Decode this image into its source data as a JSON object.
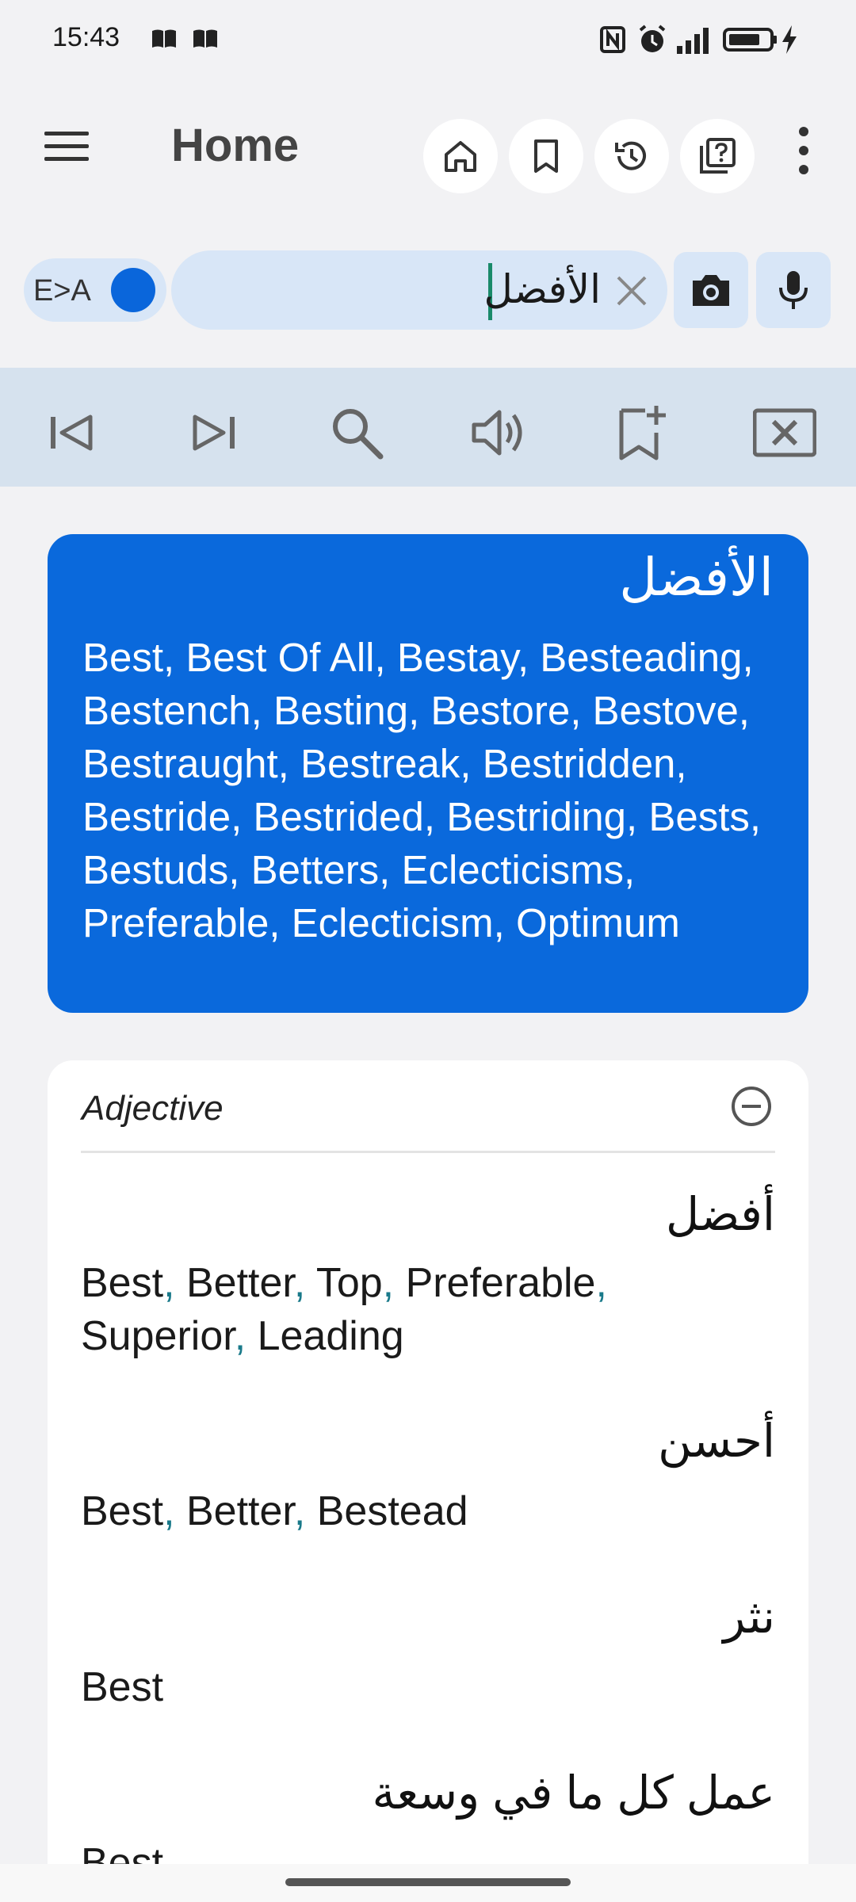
{
  "status_bar": {
    "time": "15:43",
    "left_icons": [
      "book-icon",
      "book-icon"
    ],
    "right_icons": [
      "nfc-icon",
      "alarm-icon",
      "signal-icon",
      "battery-icon",
      "charging-icon"
    ]
  },
  "app_bar": {
    "title": "Home",
    "actions": [
      "home-icon",
      "bookmark-icon",
      "history-icon",
      "quiz-icon",
      "overflow-icon"
    ]
  },
  "search": {
    "lang_toggle_label": "E>A",
    "query": "الأفضل",
    "buttons": [
      "camera-icon",
      "microphone-icon"
    ]
  },
  "toolbar": {
    "icons": [
      "skip-previous-icon",
      "skip-next-icon",
      "search-icon",
      "speaker-icon",
      "bookmark-add-icon",
      "close-box-icon"
    ]
  },
  "summary": {
    "word": "الأفضل",
    "translations": "Best, Best Of All, Bestay, Besteading, Bestench, Besting, Bestore, Bestove, Bestraught, Bestreak, Bestridden, Bestride, Bestrided, Bestriding, Bests, Bestuds, Betters, Eclecticisms, Preferable, Eclecticism, Optimum"
  },
  "detail": {
    "part_of_speech": "Adjective",
    "entries": [
      {
        "arabic": "أفضل",
        "english": [
          "Best",
          "Better",
          "Top",
          "Preferable",
          "Superior",
          "Leading"
        ]
      },
      {
        "arabic": "أحسن",
        "english": [
          "Best",
          "Better",
          "Bestead"
        ]
      },
      {
        "arabic": "نثر",
        "english": [
          "Best"
        ]
      },
      {
        "arabic": "عمل كل ما في وسعة",
        "english": [
          "Best"
        ]
      }
    ]
  },
  "colors": {
    "accent": "#0a69dc",
    "search_bg": "#d8e6f7",
    "toolbar_bg": "#d6e2ee",
    "background": "#f2f2f4"
  }
}
